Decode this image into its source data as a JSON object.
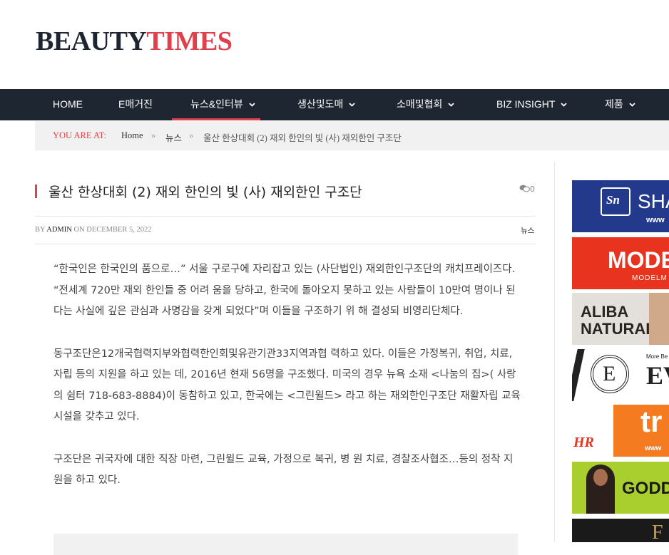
{
  "logo": {
    "part1": "BEAUTY",
    "part2": "TIMES"
  },
  "nav": [
    {
      "label": "HOME",
      "has_dropdown": false
    },
    {
      "label": "E매거진",
      "has_dropdown": false
    },
    {
      "label": "뉴스&인터뷰",
      "has_dropdown": true,
      "active": true
    },
    {
      "label": "생산및도매",
      "has_dropdown": true
    },
    {
      "label": "소매및협회",
      "has_dropdown": true
    },
    {
      "label": "BIZ INSIGHT",
      "has_dropdown": true
    },
    {
      "label": "제품",
      "has_dropdown": true
    }
  ],
  "breadcrumb": {
    "prefix": "YOU ARE AT:",
    "items": [
      "Home",
      "뉴스",
      "울산 한상대회 (2) 재외 한인의 빛 (사) 재외한인 구조단"
    ],
    "separator": "»"
  },
  "article": {
    "title": "울산 한상대회 (2) 재외 한인의 빛 (사) 재외한인 구조단",
    "comment_count": "0",
    "meta": {
      "by": "BY",
      "author": "ADMIN",
      "on": "ON",
      "date": "DECEMBER 5, 2022"
    },
    "category": "뉴스",
    "paragraphs": [
      "“한국인은 한국인의 품으로…” 서울 구로구에 자리잡고 있는 (사단법인) 재외한인구조단의 캐치프레이즈다. “전세계 720만 재외 한인들 중 어려 움을 당하고, 한국에 돌아오지 못하고 있는 사람들이 10만여 명이나 된 다는 사실에 깊은 관심과 사명감을 갖게 되었다”며 이들을 구조하기 위 해 결성되 비영리단체다.",
      "동구조단은12개국협력지부와협력한인회및유관기관33지역과협 력하고 있다. 이들은 가정복귀, 취업, 치료, 자립 등의 지원을 하고 있는 데, 2016년 현재 56명을 구조했다. 미국의 경우 뉴욕 소재 <나눔의 집>( 사랑의 쉼터 718-683-8884)이 동참하고 있고, 한국에는 <그린윌드> 라고 하는 재외한인구조단 재활자립 교육시설을 갖추고 있다.",
      "구조단은 귀국자에 대한 직장 마련, 그린윌드 교육, 가정으로 복귀, 병 원 치료, 경찰조사협조…등의 정착 지원을 하고 있다."
    ]
  },
  "sidebar_ads": [
    {
      "text": "SHA",
      "sub": "www",
      "logo": "Sn",
      "bg": "#233a8c"
    },
    {
      "text": "MODE",
      "sub": "MODELM",
      "bg": "#e8331f"
    },
    {
      "text": "ALIBA",
      "text2": "NATURAL",
      "bg": "#e3e0dc"
    },
    {
      "text": "EV",
      "mark": "E",
      "tag": "More Be",
      "bg": "#ffffff"
    },
    {
      "text": "tr",
      "sub": "www",
      "mark": "HR",
      "bg": "#f47b20"
    },
    {
      "text": "GODD",
      "bg": "#a9cf2f"
    },
    {
      "text": "F",
      "bg": "#1a1a1a"
    }
  ],
  "colors": {
    "accent": "#e0404b",
    "nav_bg": "#1e2731",
    "crumb_bg": "#f1f1f1"
  }
}
